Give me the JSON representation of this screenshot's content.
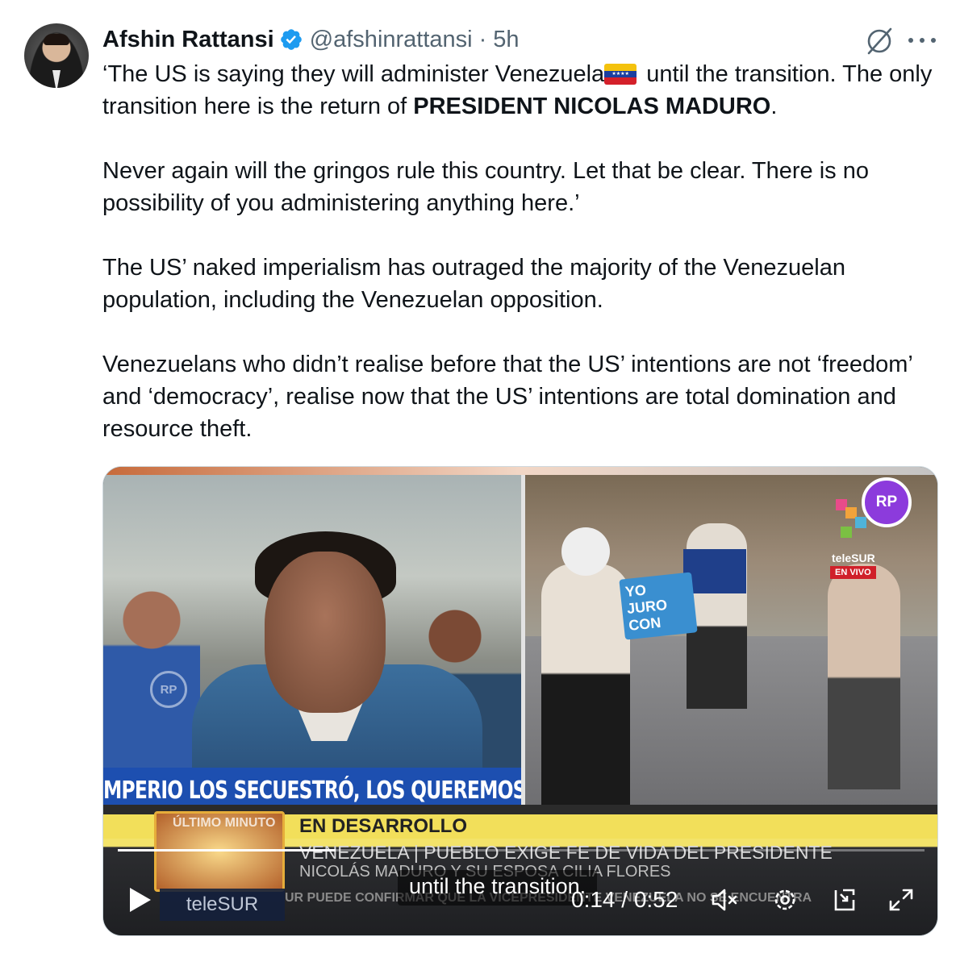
{
  "author": {
    "name": "Afshin Rattansi",
    "handle": "@afshinrattansi",
    "separator": "·",
    "time": "5h"
  },
  "body": {
    "p1_a": "‘The US is saying they will administer Venezuela",
    "p1_b": " until the transition. The only transition here is the return of ",
    "p1_bold": "PRESIDENT NICOLAS MADURO",
    "p1_end": ".",
    "p2": "Never again will the gringos rule this country. Let that be clear. There is no possibility of you administering anything here.’",
    "p3": "The US’ naked imperialism has outraged the majority of the Venezuelan population, including the Venezuelan opposition.",
    "p4": "Venezuelans who didn’t realise before that the US’ intentions are not ‘freedom’ and ‘democracy’, realise now that the US’ intentions are total domination and resource theft."
  },
  "icons": {
    "verified": "verified-badge-icon",
    "grok": "grok-icon",
    "more": "more-icon"
  },
  "video": {
    "banner_left": "MPERIO LOS SECUESTRÓ, LOS QUEREMOS DE V",
    "watermark": "RP",
    "logo": "RP",
    "channel_small": "teleSUR",
    "live_badge": "EN VIVO",
    "sign_text": "YO JURO CON",
    "lower_label": "EN DESARROLLO",
    "headline_1": "VENEZUELA | PUEBLO EXIGE FE DE VIDA DEL PRESIDENTE",
    "headline_2": "NICOLÁS MADURO Y SU ESPOSA CILIA FLORES",
    "headline_3": "UR PUEDE CONFIRMAR QUE LA VICEPRESIDENTE VENEZUELA NO SE ENCUENTRA",
    "ultimo": "ÚLTIMO MINUTO",
    "channel_big": "teleSUR",
    "caption": "until the transition.",
    "current_time": "0:14",
    "duration": "0:52",
    "time_display": "0:14 / 0:52",
    "progress": 0.27,
    "brand_purple": "#8c3bdc",
    "ticker_yellow": "#f2df5a"
  },
  "colors": {
    "verified_blue": "#1d9bf0",
    "secondary_text": "#536471"
  }
}
